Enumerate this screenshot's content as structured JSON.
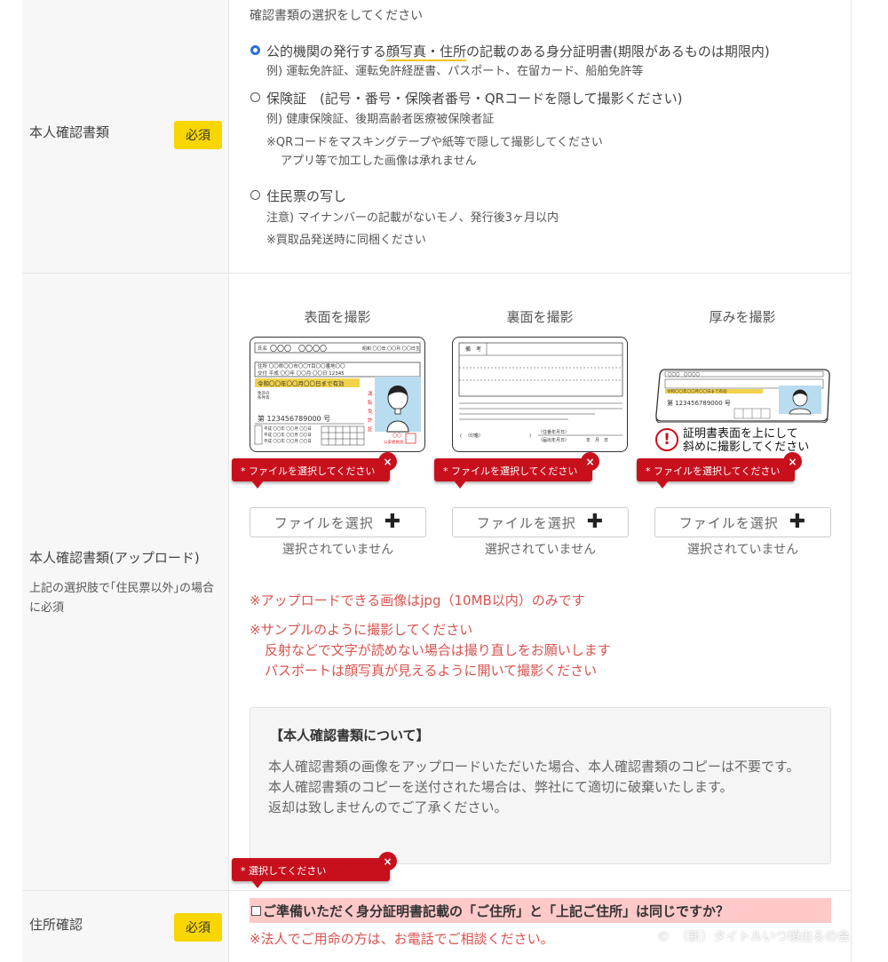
{
  "doc_section": {
    "label": "本人確認書類",
    "required": "必須",
    "question": "確認書類の選択をしてください",
    "options": [
      {
        "selected": true,
        "label_pre": "公的機関の発行する",
        "label_hl": "顔写真・住所",
        "label_post": "の記載のある身分証明書(期限があるものは期限内)",
        "sub1": "例) 運転免許証、運転免許経歴書、パスポート、在留カード、船舶免許等"
      },
      {
        "selected": false,
        "label": "保険証　(記号・番号・保険者番号・QRコードを隠して撮影ください)",
        "sub1": "例) 健康保険証、後期高齢者医療被保険者証",
        "sub2": "※QRコードをマスキングテープや紙等で隠して撮影してください",
        "sub3": "アプリ等で加工した画像は承れません"
      },
      {
        "selected": false,
        "label": "住民票の写し",
        "sub1": "注意) マイナンバーの記載がないモノ、発行後3ヶ月以内",
        "sub2": "※買取品発送時に同梱ください"
      }
    ]
  },
  "upload_section": {
    "label": "本人確認書類(アップロード)",
    "sublabel": "上記の選択肢で｢住民票以外｣の場合に必須",
    "columns": [
      {
        "heading": "表面を撮影",
        "error": "* ファイルを選択してください",
        "button": "ファイルを選択",
        "status": "選択されていません"
      },
      {
        "heading": "裏面を撮影",
        "error": "* ファイルを選択してください",
        "button": "ファイルを選択",
        "status": "選択されていません"
      },
      {
        "heading": "厚みを撮影",
        "error": "* ファイルを選択してください",
        "button": "ファイルを選択",
        "status": "選択されていません"
      }
    ],
    "card_front": {
      "name_label": "氏名",
      "name_value": "〇〇〇　〇〇〇〇",
      "birth": "昭和 〇〇年 〇〇月 〇〇日生",
      "address": "住所 〇〇県〇〇市〇〇T目〇〇番地〇〇",
      "issue": "交付 平成 〇〇年 〇〇月 〇〇日 12345",
      "expiry": "令和〇〇年〇〇月〇〇日まで有効",
      "number": "第 123456789000 号",
      "side_text": "運転免許証",
      "seal": "〇〇 公安委員会"
    },
    "card_back": {
      "remarks": "備　考",
      "seal_label": "〈印鑑〉",
      "date_label": "〈住番年月日〉",
      "date_suffix": "年　月　日"
    },
    "card_thick": {
      "number": "第 123456789000 号"
    },
    "thick_note_line1": "証明書表面を上にして",
    "thick_note_line2": "斜めに撮影してください",
    "notes": [
      "※アップロードできる画像はjpg（10MB以内）のみです",
      "※サンプルのように撮影してください",
      "反射などで文字が読めない場合は撮り直しをお願いします",
      "パスポートは顔写真が見えるように開いて撮影ください"
    ],
    "info_title": "【本人確認書類について】",
    "info_body": "本人確認書類の画像をアップロードいただいた場合、本人確認書類のコピーは不要です。",
    "info_body2": "本人確認書類のコピーを送付された場合は、弊社にて適切に破棄いたします。",
    "info_body3": "返却は致しませんのでご了承ください。"
  },
  "address_section": {
    "error": "* 選択してください",
    "label": "住所確認",
    "required": "必須",
    "question": "ご準備いただく身分証明書記載の「ご住所」と「上記ご住所」は同じですか？",
    "note": "※法人でご用命の方は、お電話でご相談ください。"
  },
  "watermark": "©　（新）タイトルいつ頃出るの会",
  "colors": {
    "required_bg": "#f8d600",
    "error_red": "#c8101d",
    "note_red": "#d9534f",
    "radio_blue": "#2d6fd6",
    "highlight_pink": "#ffc9c9"
  }
}
